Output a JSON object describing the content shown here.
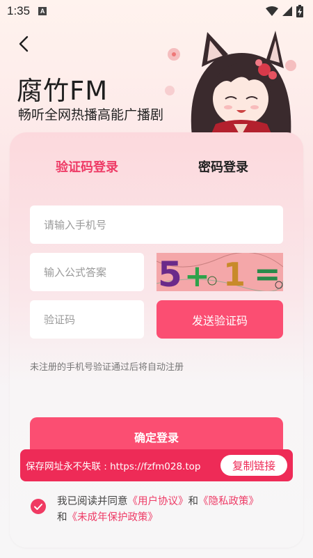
{
  "status_bar": {
    "time": "1:35",
    "notification_icon": "a-box-icon",
    "wifi_icon": "wifi-icon",
    "signal_icon": "signal-icon",
    "battery_icon": "battery-charging-icon"
  },
  "header": {
    "back_icon": "chevron-left-icon",
    "app_name": "腐竹FM",
    "slogan": "畅听全网热播高能广播剧"
  },
  "tabs": {
    "sms_login": "验证码登录",
    "password_login": "密码登录",
    "active": "sms_login"
  },
  "form": {
    "phone_placeholder": "请输入手机号",
    "formula_placeholder": "输入公式答案",
    "code_placeholder": "验证码",
    "captcha": "5+1=",
    "send_code_label": "发送验证码",
    "hint": "未注册的手机号验证通过后将自动注册",
    "login_label": "确定登录"
  },
  "banner": {
    "text": "保存网址永不失联 : https://fzfm028.top",
    "copy_label": "复制链接"
  },
  "agreement": {
    "checked": true,
    "prefix": "我已阅读并同意",
    "user_agreement": "《用户协议》",
    "and1": "和",
    "privacy_policy": "《隐私政策》",
    "and2": "和",
    "minor_policy": "《未成年保护政策》"
  },
  "colors": {
    "accent": "#fb4e72",
    "active_tab": "#ee3b66",
    "banner": "#ee2b57"
  }
}
